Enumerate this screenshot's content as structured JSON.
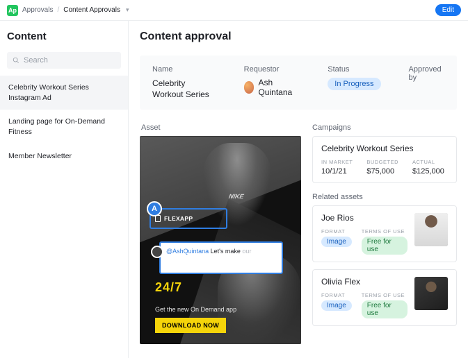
{
  "topbar": {
    "app_badge": "Ap",
    "crumb_root": "Approvals",
    "crumb_current": "Content Approvals",
    "edit_label": "Edit"
  },
  "sidebar": {
    "title": "Content",
    "search_placeholder": "Search",
    "items": [
      {
        "label": "Celebrity Workout Series Instagram Ad"
      },
      {
        "label": "Landing page for On-Demand Fitness"
      },
      {
        "label": "Member Newsletter"
      }
    ]
  },
  "main": {
    "title": "Content approval",
    "info": {
      "name_label": "Name",
      "name_value": "Celebrity Workout Series",
      "requestor_label": "Requestor",
      "requestor_value": "Ash Quintana",
      "status_label": "Status",
      "status_value": "In Progress",
      "approved_by_label": "Approved by",
      "approved_by_value": ""
    },
    "asset": {
      "section_label": "Asset",
      "brand_mark": "NIKE",
      "headline": "24/7",
      "tagline": "Get the new On Demand app",
      "cta": "DOWNLOAD NOW",
      "annotation_badge": "A",
      "annotation_label": "FLEXAPP",
      "comment_mention": "@AshQuintana",
      "comment_typed": " Let's make ",
      "comment_ghost": "our"
    },
    "campaigns": {
      "section_label": "Campaigns",
      "title": "Celebrity Workout Series",
      "in_market_label": "IN MARKET",
      "in_market_value": "10/1/21",
      "budgeted_label": "BUDGETED",
      "budgeted_value": "$75,000",
      "actual_label": "ACTUAL",
      "actual_value": "$125,000"
    },
    "related": {
      "section_label": "Related assets",
      "items": [
        {
          "name": "Joe Rios",
          "format_label": "FORMAT",
          "format_value": "Image",
          "terms_label": "TERMS OF USE",
          "terms_value": "Free for use"
        },
        {
          "name": "Olivia Flex",
          "format_label": "FORMAT",
          "format_value": "Image",
          "terms_label": "TERMS OF USE",
          "terms_value": "Free for use"
        }
      ]
    }
  }
}
